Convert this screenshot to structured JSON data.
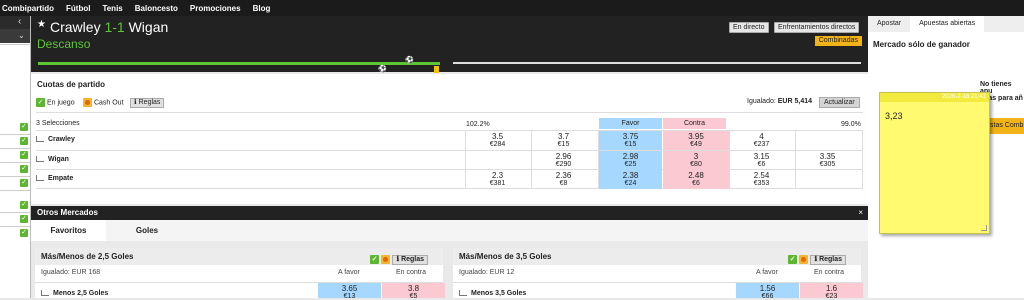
{
  "topnav": {
    "items": [
      "Combipartido",
      "Fútbol",
      "Tenis",
      "Baloncesto",
      "Promociones",
      "Blog"
    ]
  },
  "left": {
    "back_icon": "chevron-left-icon",
    "down_icon": "chevron-down-icon"
  },
  "event": {
    "home": "Crawley",
    "score": "1-1",
    "away": "Wigan",
    "status": "Descanso",
    "btn_live": "En directo",
    "btn_h2h": "Enfrentamientos directos",
    "btn_combi": "Combinadas"
  },
  "match_odds": {
    "title": "Cuotas de partido",
    "filters": {
      "in_play": "En juego",
      "cash_out": "Cash Out",
      "rules": "Reglas"
    },
    "matched_label": "Igualado:",
    "matched_value": "EUR 5,414",
    "refresh": "Actualizar",
    "selections": "3 Selecciones",
    "back_pct": "102.2%",
    "lay_pct": "99.0%",
    "back_header": "Favor",
    "lay_header": "Contra",
    "rows": [
      {
        "name": "Crawley",
        "cells": [
          [
            "3.5",
            "€284"
          ],
          [
            "3.7",
            "€15"
          ],
          [
            "3.75",
            "€15"
          ],
          [
            "3.95",
            "€49"
          ],
          [
            "4",
            "€237"
          ],
          [
            "",
            ""
          ]
        ]
      },
      {
        "name": "Wigan",
        "cells": [
          [
            "",
            ""
          ],
          [
            "2.96",
            "€290"
          ],
          [
            "2.98",
            "€25"
          ],
          [
            "3",
            "€80"
          ],
          [
            "3.15",
            "€6"
          ],
          [
            "3.35",
            "€305"
          ]
        ]
      },
      {
        "name": "Empate",
        "cells": [
          [
            "2.3",
            "€381"
          ],
          [
            "2.36",
            "€8"
          ],
          [
            "2.38",
            "€24"
          ],
          [
            "2.48",
            "€6"
          ],
          [
            "2.54",
            "€353"
          ],
          [
            "",
            ""
          ]
        ]
      }
    ]
  },
  "other_markets": {
    "title": "Otros Mercados",
    "close": "×",
    "tabs": [
      "Favoritos",
      "Goles"
    ],
    "panels": [
      {
        "title": "Más/Menos de 2,5 Goles",
        "rules": "Reglas",
        "matched": "Igualado: EUR 168",
        "back_label": "A favor",
        "lay_label": "En contra",
        "row": "Menos 2,5 Goles",
        "back": [
          "3.65",
          "€13"
        ],
        "lay": [
          "3.8",
          "€5"
        ]
      },
      {
        "title": "Más/Menos de 3,5 Goles",
        "rules": "Reglas",
        "matched": "Igualado: EUR 12",
        "back_label": "A favor",
        "lay_label": "En contra",
        "row": "Menos 3,5 Goles",
        "back": [
          "1.56",
          "€66"
        ],
        "lay": [
          "1.6",
          "€23"
        ]
      }
    ]
  },
  "betslip": {
    "tabs": [
      "Apostar",
      "Apuestas abiertas"
    ],
    "title": "Mercado sólo de ganador",
    "msg1": "No tienes apu",
    "msg2": "tas para añ",
    "button": "stas Combi"
  },
  "sticky": {
    "date": "2026-2-16 21:41",
    "value": "3,23"
  },
  "colors": {
    "back": "#a6d8ff",
    "lay": "#fac9d1",
    "green": "#5ec535",
    "accent": "#f1b317"
  }
}
